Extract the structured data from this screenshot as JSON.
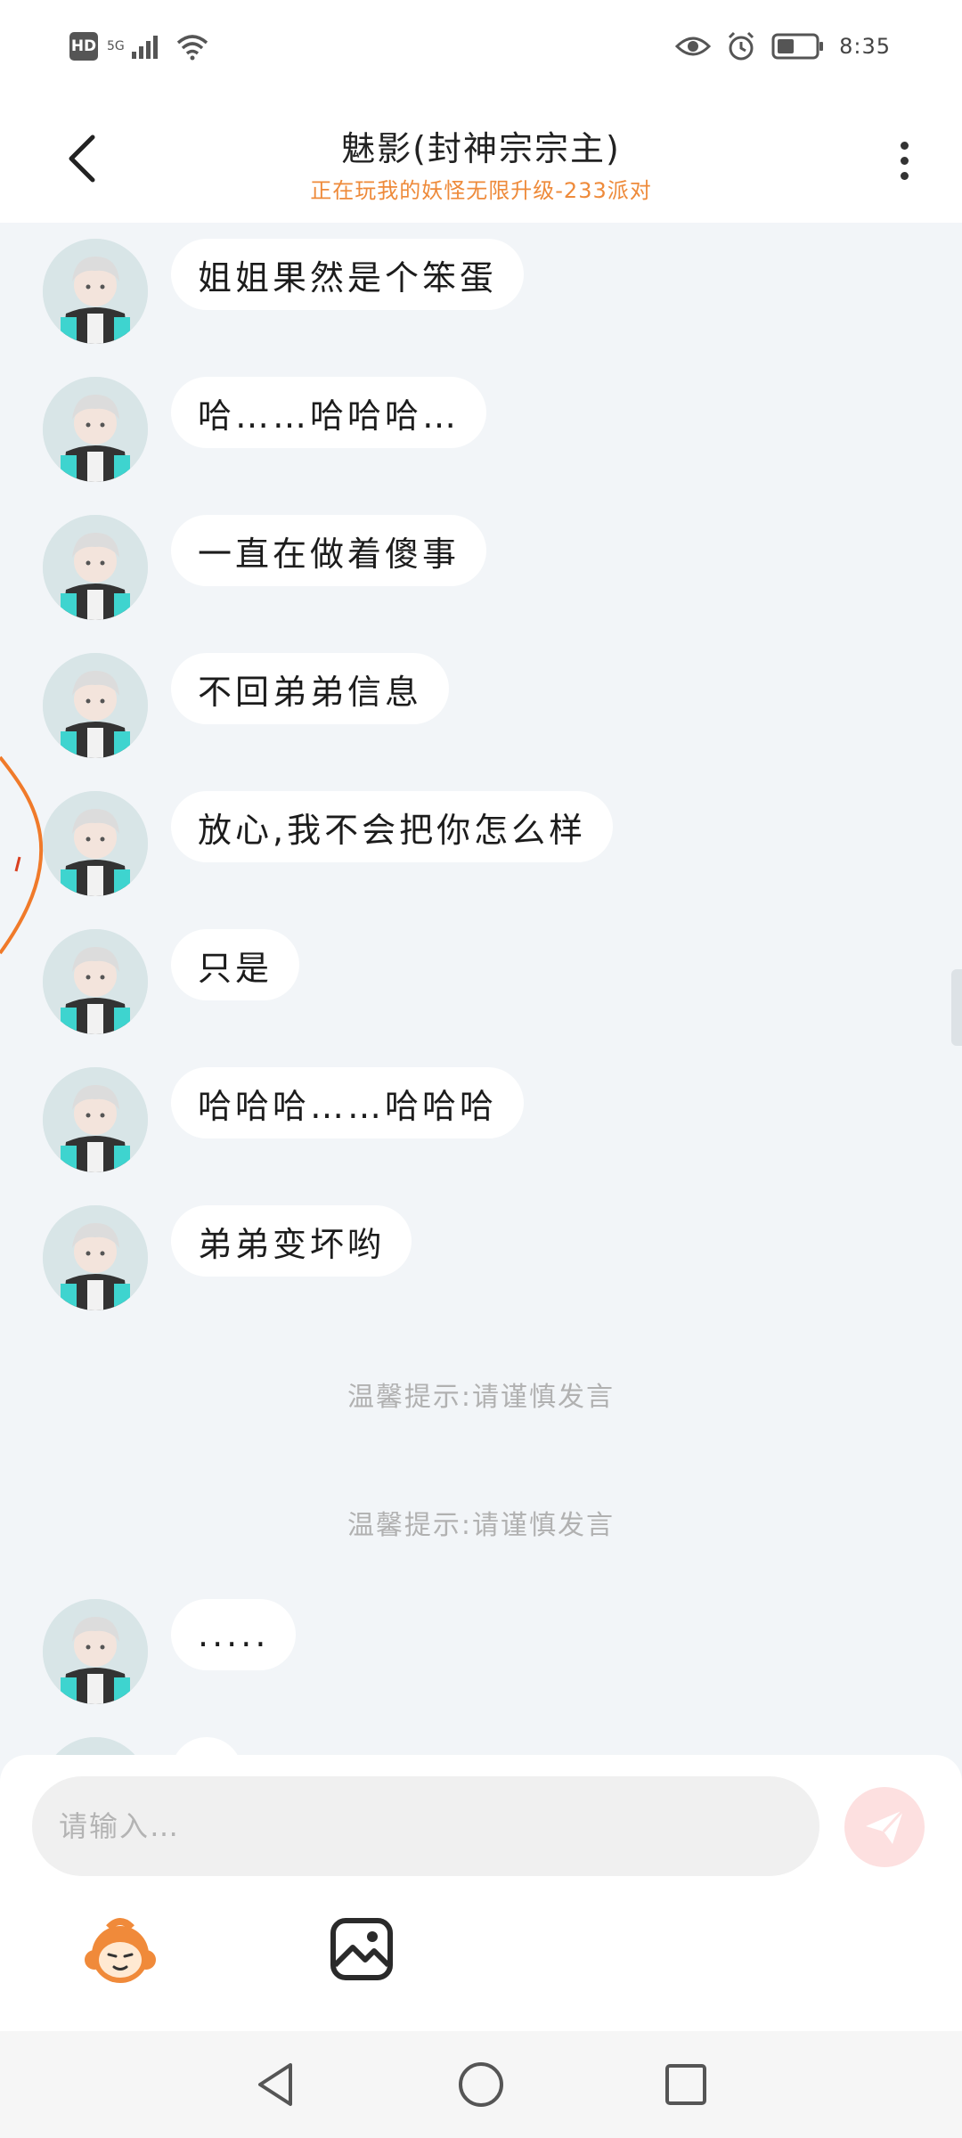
{
  "status_bar": {
    "hd_label": "HD",
    "network_label": "5G",
    "time": "8:35",
    "icons": [
      "hd-icon",
      "signal-icon",
      "wifi-icon",
      "eye-icon",
      "alarm-icon",
      "battery-icon"
    ]
  },
  "header": {
    "title": "魅影(封神宗宗主)",
    "subtitle": "正在玩我的妖怪无限升级-233派对",
    "back_icon": "chevron-left-icon",
    "more_icon": "more-vertical-icon"
  },
  "messages": [
    {
      "text": "姐姐果然是个笨蛋"
    },
    {
      "text": "哈……哈哈哈…"
    },
    {
      "text": "一直在做着傻事"
    },
    {
      "text": "不回弟弟信息"
    },
    {
      "text": "放心,我不会把你怎么样"
    },
    {
      "text": "只是"
    },
    {
      "text": "哈哈哈……哈哈哈"
    },
    {
      "text": "弟弟变坏哟"
    },
    {
      "text": "....."
    }
  ],
  "tips": [
    "温馨提示:请谨慎发言",
    "温馨提示:请谨慎发言"
  ],
  "input": {
    "placeholder": "请输入…",
    "value": ""
  },
  "toolbar": {
    "icons": [
      "mascot-emoji-icon",
      "image-icon",
      "send-icon"
    ]
  },
  "colors": {
    "accent_orange": "#ee8a3a",
    "background": "#f2f5f8",
    "bubble": "#ffffff",
    "send_button": "#fde0e0",
    "tip_text": "#b1b1b1"
  },
  "nav": {
    "icons": [
      "back-triangle-icon",
      "home-circle-icon",
      "recents-square-icon"
    ]
  }
}
